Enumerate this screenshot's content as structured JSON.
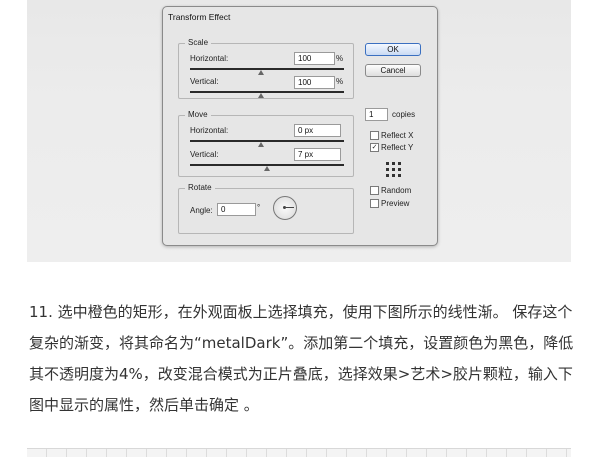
{
  "dialog": {
    "title": "Transform Effect",
    "scale": {
      "legend": "Scale",
      "horizontal_label": "Horizontal:",
      "horizontal_value": "100",
      "horizontal_unit": "%",
      "vertical_label": "Vertical:",
      "vertical_value": "100",
      "vertical_unit": "%"
    },
    "move": {
      "legend": "Move",
      "horizontal_label": "Horizontal:",
      "horizontal_value": "0 px",
      "vertical_label": "Vertical:",
      "vertical_value": "7 px"
    },
    "rotate": {
      "legend": "Rotate",
      "angle_label": "Angle:",
      "angle_value": "0",
      "angle_unit": "°"
    },
    "buttons": {
      "ok": "OK",
      "cancel": "Cancel"
    },
    "copies": {
      "value": "1",
      "label": "copies"
    },
    "options": {
      "reflect_x": "Reflect X",
      "reflect_x_checked": false,
      "reflect_y": "Reflect Y",
      "reflect_y_checked": true,
      "random": "Random",
      "random_checked": false,
      "preview": "Preview",
      "preview_checked": false
    }
  },
  "paragraph": "11. 选中橙色的矩形，在外观面板上选择填充，使用下图所示的线性渐。 保存这个复杂的渐变，将其命名为“metalDark”。添加第二个填充，设置颜色为黑色，降低其不透明度为4%，改变混合模式为正片叠底，选择效果>艺术>胶片颗粒，输入下图中显示的属性，然后单击确定 。"
}
